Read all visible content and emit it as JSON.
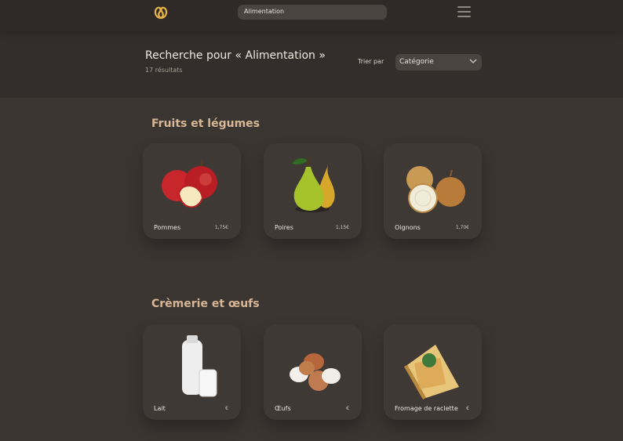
{
  "search": {
    "value": "Alimentation"
  },
  "results": {
    "title": "Recherche pour « Alimentation »",
    "count": "17 résultats",
    "sort_label": "Trier par",
    "sort_value": "Catégorie"
  },
  "colors": {
    "background": "#332e2b",
    "accent": "#d7b796",
    "card": "#3f3936"
  },
  "sections": [
    {
      "title": "Fruits et légumes",
      "items": [
        {
          "name": "Pommes",
          "price": "1,75€",
          "icon": "apples-image"
        },
        {
          "name": "Poires",
          "price": "1,15€",
          "icon": "pears-image"
        },
        {
          "name": "Oignons",
          "price": "1,70€",
          "icon": "onions-image"
        }
      ]
    },
    {
      "title": "Crèmerie et œufs",
      "items": [
        {
          "name": "Lait",
          "price": "€",
          "icon": "milk-image"
        },
        {
          "name": "Œufs",
          "price": "€",
          "icon": "eggs-image"
        },
        {
          "name": "Fromage de raclette",
          "price": "€",
          "icon": "cheese-image"
        }
      ]
    }
  ]
}
